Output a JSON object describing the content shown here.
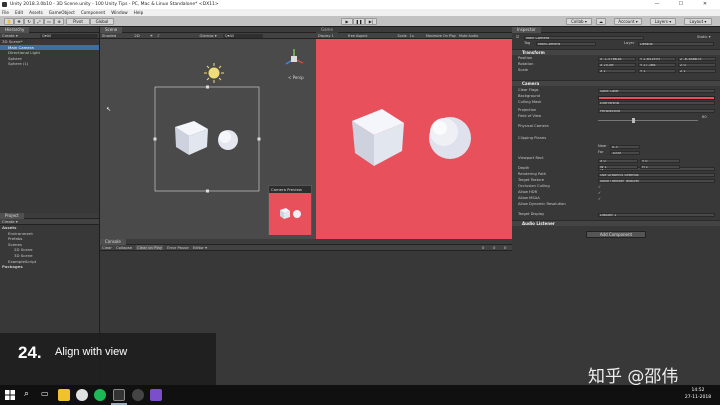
{
  "window": {
    "title": "Unity 2018.3.0b10 - 3D Scene.unity - 100 Unity Tips - PC, Mac & Linux Standalone* <DX11>",
    "minimize": "—",
    "maximize": "☐",
    "close": "✕"
  },
  "menu": [
    "File",
    "Edit",
    "Assets",
    "GameObject",
    "Component",
    "Window",
    "Help"
  ],
  "toolbar": {
    "pivot": "Pivot",
    "global": "Global",
    "collab": "Collab ▾",
    "account": "Account ▾",
    "layers": "Layers ▾",
    "layout": "Layout ▾"
  },
  "hierarchy": {
    "tab": "Hierarchy",
    "create": "Create ▾",
    "search_placeholder": "Q▾All",
    "items": [
      {
        "label": "3D Scene*",
        "indent": 0,
        "selected": false
      },
      {
        "label": "Main Camera",
        "indent": 1,
        "selected": true
      },
      {
        "label": "Directional Light",
        "indent": 1,
        "selected": false
      },
      {
        "label": "Sphere",
        "indent": 1,
        "selected": false
      },
      {
        "label": "Sphere (1)",
        "indent": 1,
        "selected": false
      }
    ]
  },
  "scene": {
    "tab": "Scene",
    "shaded": "Shaded",
    "mode_2d": "2D",
    "gizmos": "Gizmos ▾",
    "search_placeholder": "Q▾All",
    "persp": "< Persp",
    "camera_preview": "Camera Preview"
  },
  "game": {
    "tab": "Game",
    "display": "Display 1",
    "aspect": "Free Aspect",
    "scale": "Scale",
    "scale_value": "1x",
    "maximize": "Maximize On Play",
    "mute": "Mute Audio",
    "stats": "Stats",
    "gizmos": "Gizmos"
  },
  "project": {
    "tab": "Project",
    "create": "Create ▾",
    "items": [
      {
        "label": "Assets",
        "indent": 0,
        "bold": true
      },
      {
        "label": "Environment",
        "indent": 1,
        "bold": false
      },
      {
        "label": "Prefabs",
        "indent": 1,
        "bold": false
      },
      {
        "label": "Scenes",
        "indent": 1,
        "bold": false
      },
      {
        "label": "2D Scene",
        "indent": 2,
        "bold": false
      },
      {
        "label": "3D Scene",
        "indent": 2,
        "bold": false
      },
      {
        "label": "ExampleScript",
        "indent": 1,
        "bold": false
      },
      {
        "label": "Packages",
        "indent": 0,
        "bold": true
      }
    ]
  },
  "console": {
    "tab": "Console",
    "buttons": [
      "Clear",
      "Collapse",
      "Clear on Play",
      "Error Pause",
      "Editor ▾"
    ],
    "counts": [
      "0",
      "0",
      "0"
    ]
  },
  "inspector": {
    "tab": "Inspector",
    "object_name": "Main Camera",
    "static": "Static ▾",
    "tag_label": "Tag",
    "tag_value": "MainCamera",
    "layer_label": "Layer",
    "layer_value": "Default",
    "transform": {
      "title": "Transform",
      "position_label": "Position",
      "rotation_label": "Rotation",
      "scale_label": "Scale",
      "position": [
        "X -1.576618",
        "Y 2.851593",
        "Z -6.388875"
      ],
      "rotation": [
        "X 25.06",
        "Y 27.168",
        "Z 0"
      ],
      "scale": [
        "X 1",
        "Y 1",
        "Z 1"
      ]
    },
    "camera": {
      "title": "Camera",
      "rows": [
        {
          "label": "Clear Flags",
          "value": "Solid Color"
        },
        {
          "label": "Background",
          "value": ""
        },
        {
          "label": "Culling Mask",
          "value": "Everything"
        },
        {
          "label": "Projection",
          "value": "Perspective"
        },
        {
          "label": "Field of View",
          "value": "60"
        },
        {
          "label": "Physical Camera",
          "value": ""
        },
        {
          "label": "Clipping Planes",
          "value": ""
        },
        {
          "label": "Viewport Rect",
          "value": ""
        },
        {
          "label": "Depth",
          "value": "-1"
        },
        {
          "label": "Rendering Path",
          "value": "Use Graphics Settings"
        },
        {
          "label": "Target Texture",
          "value": "None (Render Texture)"
        },
        {
          "label": "Occlusion Culling",
          "value": "✓"
        },
        {
          "label": "Allow HDR",
          "value": "✓"
        },
        {
          "label": "Allow MSAA",
          "value": "✓"
        },
        {
          "label": "Allow Dynamic Resolution",
          "value": ""
        },
        {
          "label": "Target Display",
          "value": "Display 1"
        }
      ],
      "near_label": "Near",
      "near_value": "0.3",
      "far_label": "Far",
      "far_value": "1000",
      "viewport": [
        "X 0",
        "Y 0",
        "W 1",
        "H 1"
      ]
    },
    "audio_listener": "Audio Listener",
    "add_component": "Add Component"
  },
  "caption": {
    "number": "24.",
    "text": "Align with view"
  },
  "watermark": "知乎 @邵伟",
  "taskbar": {
    "time": "14:52",
    "date": "27-11-2018"
  },
  "colors": {
    "game_background": "#e8505b",
    "selection": "#3e6ea8",
    "editor_dark": "#383838"
  }
}
